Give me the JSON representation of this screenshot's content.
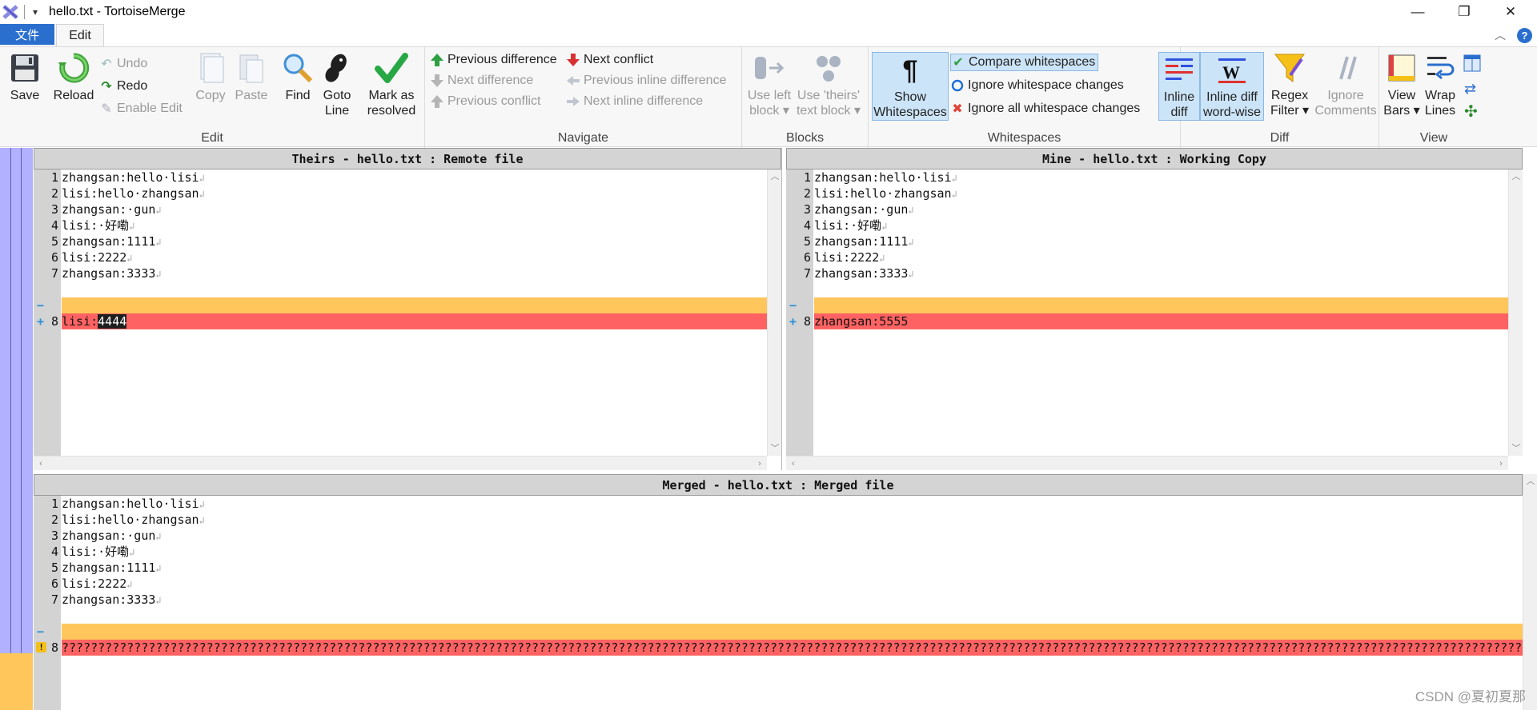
{
  "window": {
    "title": "hello.txt - TortoiseMerge",
    "qat": "▾",
    "minimize": "—",
    "restore": "❐",
    "close": "✕"
  },
  "tabs": {
    "file": "文件",
    "edit": "Edit",
    "collapse": "︿",
    "help": "?"
  },
  "ribbon": {
    "edit_group": {
      "label": "Edit",
      "save": "Save",
      "reload": "Reload",
      "undo": "Undo",
      "redo": "Redo",
      "enable_edit": "Enable Edit",
      "copy": "Copy",
      "paste": "Paste",
      "find": "Find",
      "goto_line": [
        "Goto",
        "Line"
      ],
      "mark_resolved": [
        "Mark as",
        "resolved"
      ]
    },
    "navigate_group": {
      "label": "Navigate",
      "prev_difference": "Previous difference",
      "next_conflict": "Next conflict",
      "next_difference": "Next difference",
      "prev_inline": "Previous inline difference",
      "prev_conflict": "Previous conflict",
      "next_inline": "Next inline difference"
    },
    "blocks_group": {
      "label": "Blocks",
      "use_left": [
        "Use left",
        "block"
      ],
      "use_theirs": [
        "Use 'theirs'",
        "text block"
      ]
    },
    "whitespaces_group": {
      "label": "Whitespaces",
      "show_whitespaces": [
        "Show",
        "Whitespaces"
      ],
      "compare": "Compare whitespaces",
      "ignore_changes": "Ignore whitespace changes",
      "ignore_all": "Ignore all whitespace changes"
    },
    "diff_group": {
      "label": "Diff",
      "inline_diff": [
        "Inline",
        "diff"
      ],
      "inline_word": [
        "Inline diff",
        "word-wise"
      ],
      "regex_filter": [
        "Regex",
        "Filter"
      ],
      "ignore_comments": [
        "Ignore",
        "Comments"
      ]
    },
    "view_group": {
      "label": "View",
      "view_bars": [
        "View",
        "Bars"
      ],
      "wrap_lines": [
        "Wrap",
        "Lines"
      ]
    }
  },
  "colors": {
    "accent": "#2b6fce",
    "conflict_yellow": "#ffc65c",
    "conflict_red": "#ff6262",
    "gutter_purple": "#b1b1ff"
  },
  "panes": {
    "theirs": {
      "header": "Theirs - hello.txt : Remote file",
      "lines": [
        {
          "n": "1",
          "text": "zhangsan:hello·lisi"
        },
        {
          "n": "2",
          "text": "lisi:hello·zhangsan"
        },
        {
          "n": "3",
          "text": "zhangsan:·gun"
        },
        {
          "n": "4",
          "text": "lisi:·好嘞"
        },
        {
          "n": "5",
          "text": "zhangsan:1111"
        },
        {
          "n": "6",
          "text": "lisi:2222"
        },
        {
          "n": "7",
          "text": "zhangsan:3333"
        }
      ],
      "removed_marker": "−",
      "added_marker": "+",
      "conflict_line": {
        "n": "8",
        "prefix": "lisi:",
        "highlight": "4444"
      }
    },
    "mine": {
      "header": "Mine - hello.txt : Working Copy",
      "lines": [
        {
          "n": "1",
          "text": "zhangsan:hello·lisi"
        },
        {
          "n": "2",
          "text": "lisi:hello·zhangsan"
        },
        {
          "n": "3",
          "text": "zhangsan:·gun"
        },
        {
          "n": "4",
          "text": "lisi:·好嘞"
        },
        {
          "n": "5",
          "text": "zhangsan:1111"
        },
        {
          "n": "6",
          "text": "lisi:2222"
        },
        {
          "n": "7",
          "text": "zhangsan:3333"
        }
      ],
      "removed_marker": "−",
      "added_marker": "+",
      "conflict_line": {
        "n": "8",
        "text": "zhangsan:5555"
      }
    },
    "merged": {
      "header": "Merged - hello.txt : Merged file",
      "lines": [
        {
          "n": "1",
          "text": "zhangsan:hello·lisi"
        },
        {
          "n": "2",
          "text": "lisi:hello·zhangsan"
        },
        {
          "n": "3",
          "text": "zhangsan:·gun"
        },
        {
          "n": "4",
          "text": "lisi:·好嘞"
        },
        {
          "n": "5",
          "text": "zhangsan:1111"
        },
        {
          "n": "6",
          "text": "lisi:2222"
        },
        {
          "n": "7",
          "text": "zhangsan:3333"
        }
      ],
      "removed_marker": "−",
      "warn_marker": "!",
      "conflict_line": {
        "n": "8",
        "text": "??????????????????????????????????????????????????????????????????????????????????????????????????????????????????????????????????????????????????????????????????????????????????????????????????????????????????"
      }
    }
  },
  "return_glyph": "↲",
  "watermark": "CSDN @夏初夏那"
}
